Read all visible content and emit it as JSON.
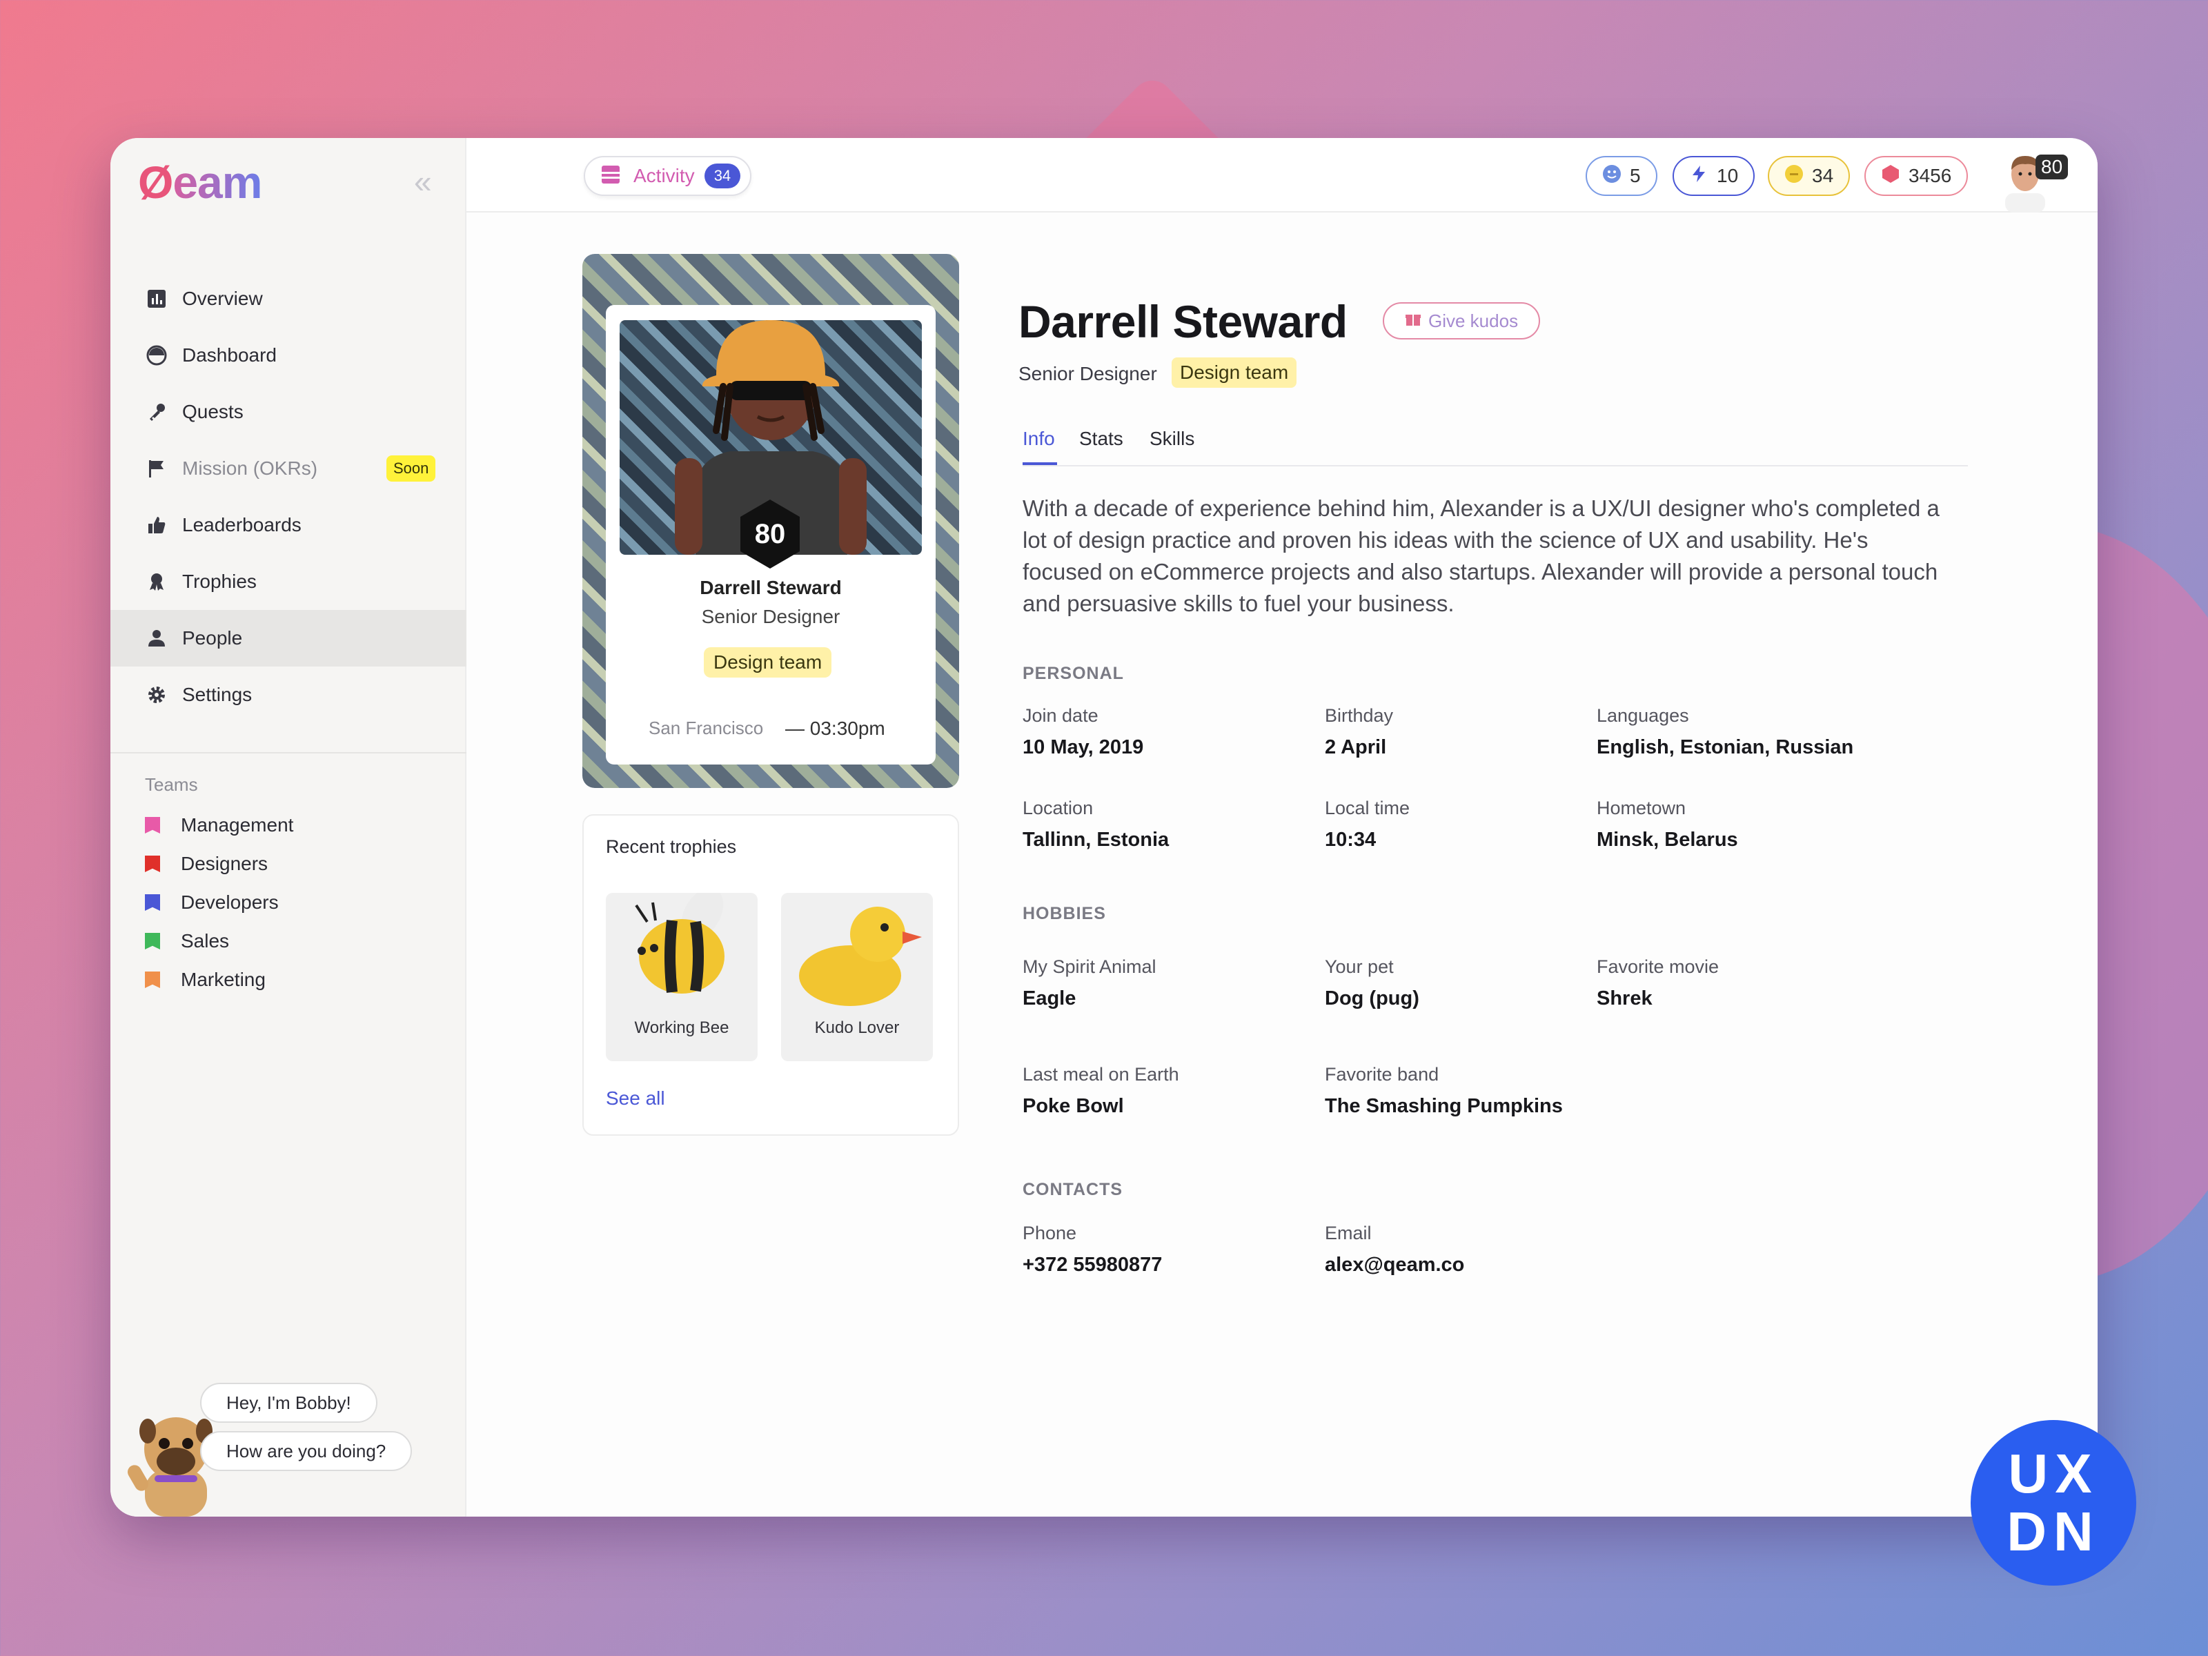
{
  "app": {
    "logo_q": "Ø",
    "logo_rest": "eam"
  },
  "sidebar": {
    "collapse": "«",
    "nav": [
      {
        "label": "Overview",
        "icon": "bar-chart-icon"
      },
      {
        "label": "Dashboard",
        "icon": "gauge-icon"
      },
      {
        "label": "Quests",
        "icon": "key-icon"
      },
      {
        "label": "Mission (OKRs)",
        "icon": "flag-icon",
        "badge": "Soon"
      },
      {
        "label": "Leaderboards",
        "icon": "thumbs-up-icon"
      },
      {
        "label": "Trophies",
        "icon": "medal-icon"
      },
      {
        "label": "People",
        "icon": "person-icon",
        "active": true
      },
      {
        "label": "Settings",
        "icon": "gear-icon"
      }
    ],
    "teams_title": "Teams",
    "teams": [
      {
        "label": "Management",
        "color": "#e85aa8"
      },
      {
        "label": "Designers",
        "color": "#e0302a"
      },
      {
        "label": "Developers",
        "color": "#4a57d6"
      },
      {
        "label": "Sales",
        "color": "#3fb85a"
      },
      {
        "label": "Marketing",
        "color": "#f0904a"
      }
    ],
    "bobby": {
      "line1": "Hey, I'm Bobby!",
      "line2": "How are you doing?"
    }
  },
  "topbar": {
    "activity_label": "Activity",
    "activity_count": "34",
    "stats": [
      {
        "value": "5",
        "icon": "smiley-icon",
        "border": "#7b9ce6",
        "color": "#6c8ee0"
      },
      {
        "value": "10",
        "icon": "lightning-icon",
        "border": "#4a57d6",
        "color": "#4a57d6"
      },
      {
        "value": "34",
        "icon": "coin-icon",
        "border": "#e8c23a",
        "color": "#e8c23a"
      },
      {
        "value": "3456",
        "icon": "gem-icon",
        "border": "#ec8a9a",
        "color": "#e85a72"
      }
    ],
    "user_level": "80"
  },
  "profile_card": {
    "level": "80",
    "name": "Darrell Steward",
    "role": "Senior Designer",
    "team": "Design team",
    "location": "San Francisco",
    "time": "— 03:30pm"
  },
  "trophies": {
    "title": "Recent trophies",
    "items": [
      {
        "label": "Working Bee"
      },
      {
        "label": "Kudo Lover"
      }
    ],
    "see_all": "See all"
  },
  "profile": {
    "name": "Darrell Steward",
    "kudos": "Give kudos",
    "role": "Senior Designer",
    "team": "Design team",
    "tabs": [
      "Info",
      "Stats",
      "Skills"
    ],
    "bio": "With a decade of experience behind him, Alexander is a UX/UI designer who's completed a lot of design practice and proven his ideas with the science of UX and usability. He's focused on eCommerce projects and also startups. Alexander will provide a personal touch and persuasive skills to fuel your business.",
    "personal": {
      "title": "PERSONAL",
      "fields": [
        {
          "label": "Join date",
          "value": "10 May, 2019"
        },
        {
          "label": "Birthday",
          "value": "2 April"
        },
        {
          "label": "Languages",
          "value": "English, Estonian, Russian"
        },
        {
          "label": "Location",
          "value": "Tallinn, Estonia"
        },
        {
          "label": "Local time",
          "value": "10:34"
        },
        {
          "label": "Hometown",
          "value": "Minsk, Belarus"
        }
      ]
    },
    "hobbies": {
      "title": "HOBBIES",
      "fields": [
        {
          "label": "My Spirit Animal",
          "value": "Eagle"
        },
        {
          "label": "Your pet",
          "value": "Dog (pug)"
        },
        {
          "label": "Favorite movie",
          "value": "Shrek"
        },
        {
          "label": "Last meal on Earth",
          "value": "Poke Bowl"
        },
        {
          "label": "Favorite band",
          "value": "The Smashing Pumpkins"
        }
      ]
    },
    "contacts": {
      "title": "CONTACTS",
      "fields": [
        {
          "label": "Phone",
          "value": "+372 55980877"
        },
        {
          "label": "Email",
          "value": "alex@qeam.co"
        }
      ]
    }
  },
  "watermark": {
    "line1": "UX",
    "line2": "DN"
  }
}
